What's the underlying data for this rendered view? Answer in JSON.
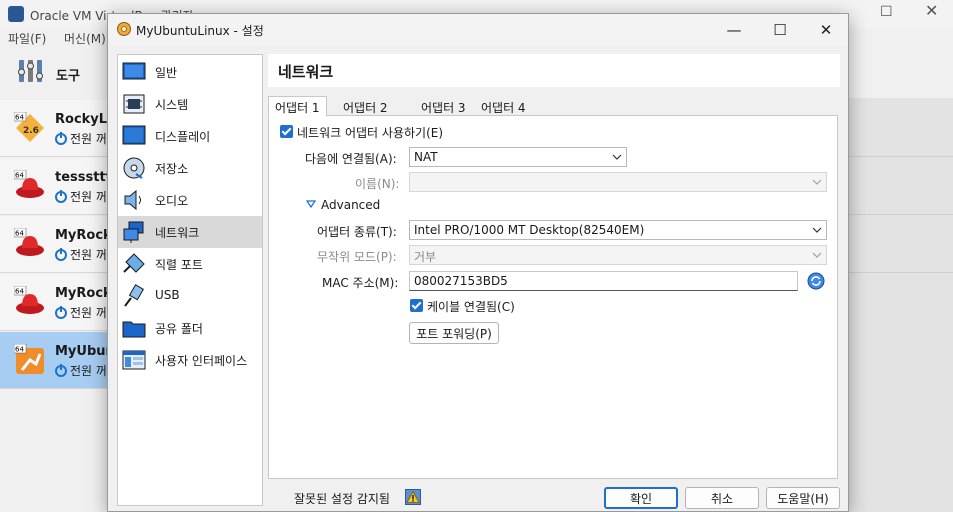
{
  "bg_window": {
    "title": "Oracle VM VirtualBox 관리자",
    "menu": [
      "파일(F)",
      "머신(M)"
    ],
    "tools_label": "도구",
    "vms": [
      {
        "name": "RockyLi",
        "state": "전원 꺼",
        "badge": "64",
        "version_badge": "2.6"
      },
      {
        "name": "tesssttt",
        "state": "전원 꺼",
        "badge": "64"
      },
      {
        "name": "MyRock",
        "state": "전원 꺼",
        "badge": "64"
      },
      {
        "name": "MyRock",
        "state": "전원 꺼",
        "badge": "64"
      },
      {
        "name": "MyUbun",
        "state": "전원 꺼",
        "badge": "64",
        "selected": true
      }
    ]
  },
  "dialog": {
    "title": "MyUbuntuLinux - 설정",
    "sidebar": [
      {
        "label": "일반",
        "icon": "monitor-icon"
      },
      {
        "label": "시스템",
        "icon": "chip-icon"
      },
      {
        "label": "디스플레이",
        "icon": "display-icon"
      },
      {
        "label": "저장소",
        "icon": "disk-icon"
      },
      {
        "label": "오디오",
        "icon": "speaker-icon"
      },
      {
        "label": "네트워크",
        "icon": "network-icon",
        "active": true
      },
      {
        "label": "직렬 포트",
        "icon": "serial-port-icon"
      },
      {
        "label": "USB",
        "icon": "usb-icon"
      },
      {
        "label": "공유 폴더",
        "icon": "folder-icon"
      },
      {
        "label": "사용자 인터페이스",
        "icon": "ui-icon"
      }
    ],
    "page_title": "네트워크",
    "tabs": [
      "어댑터 1",
      "어댑터 2",
      "어댑터 3",
      "어댑터 4"
    ],
    "enable_adapter_label": "네트워크 어댑터 사용하기(E)",
    "attached_to_label": "다음에 연결됨(A):",
    "attached_to_value": "NAT",
    "name_label": "이름(N):",
    "name_value": "",
    "advanced_label": "Advanced",
    "adapter_type_label": "어댑터 종류(T):",
    "adapter_type_value": "Intel PRO/1000 MT Desktop(82540EM)",
    "promiscuous_label": "무작위 모드(P):",
    "promiscuous_value": "거부",
    "mac_label": "MAC 주소(M):",
    "mac_value": "080027153BD5",
    "cable_connected_label": "케이블 연결됨(C)",
    "port_forwarding_label": "포트 포워딩(P)",
    "warning_text": "잘못된 설정 감지됨",
    "ok_label": "확인",
    "cancel_label": "취소",
    "help_label": "도움말(H)"
  },
  "colors": {
    "accent": "#1f6fd0",
    "selected_vm": "#a8cdf2",
    "active_sidebar": "#d9d9d9"
  }
}
